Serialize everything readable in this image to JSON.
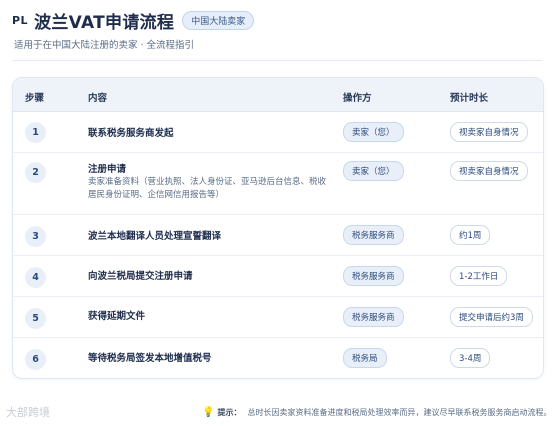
{
  "header": {
    "flag": "PL",
    "title": "波兰VAT申请流程",
    "badge": "中国大陆卖家",
    "subtitle": "适用于在中国大陆注册的卖家 · 全流程指引"
  },
  "table": {
    "columns": {
      "step": "步骤",
      "content": "内容",
      "operator": "操作方",
      "duration": "预计时长"
    },
    "rows": [
      {
        "step": "1",
        "task": "联系税务服务商发起",
        "desc": "",
        "operator": "卖家（您）",
        "duration": "视卖家自身情况"
      },
      {
        "step": "2",
        "task": "注册申请",
        "desc": "卖家准备资料（营业执照、法人身份证、亚马逊后台信息、税收居民身份证明、企信网信用报告等）",
        "operator": "卖家（您）",
        "duration": "视卖家自身情况"
      },
      {
        "step": "3",
        "task": "波兰本地翻译人员处理宣誓翻译",
        "desc": "",
        "operator": "税务服务商",
        "duration": "约1周"
      },
      {
        "step": "4",
        "task": "向波兰税局提交注册申请",
        "desc": "",
        "operator": "税务服务商",
        "duration": "1-2工作日"
      },
      {
        "step": "5",
        "task": "获得延期文件",
        "desc": "",
        "operator": "税务服务商",
        "duration": "提交申请后约3周"
      },
      {
        "step": "6",
        "task": "等待税务局签发本地增值税号",
        "desc": "",
        "operator": "税务局",
        "duration": "3-4周"
      }
    ]
  },
  "footer": {
    "watermark": "大部跨境",
    "tip_icon": "lightbulb-icon",
    "tip_label": "提示：",
    "tip_text": "总时长因卖家资料准备进度和税局处理效率而异，建议尽早联系税务服务商启动流程。"
  }
}
